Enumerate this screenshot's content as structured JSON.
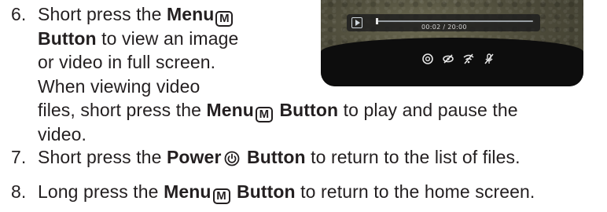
{
  "figure": {
    "timecode": "00:02 / 20:00",
    "status_icons": [
      "aperture-icon",
      "eye-off-icon",
      "wifi-off-icon",
      "mic-off-icon"
    ]
  },
  "steps": [
    {
      "number": "6.",
      "lines": [
        [
          "Short press the ",
          {
            "b": "Menu"
          },
          {
            "kbd": "M"
          }
        ],
        [
          {
            "b": "Button"
          },
          " to view an image"
        ],
        [
          "or video in full screen."
        ],
        [
          "When viewing video"
        ],
        [
          "files, short press the ",
          {
            "b": "Menu"
          },
          {
            "kbd": "M"
          },
          {
            "b": " Button"
          },
          " to play and pause the"
        ],
        [
          "video."
        ]
      ]
    },
    {
      "number": "7.",
      "lines": [
        [
          "Short press the ",
          {
            "b": "Power"
          },
          {
            "pwr": "power"
          },
          {
            "b": " Button"
          },
          " to return to the list of files."
        ]
      ]
    },
    {
      "number": "8.",
      "lines": [
        [
          "Long press the ",
          {
            "b": "Menu"
          },
          {
            "kbd": "M"
          },
          {
            "b": " Button"
          },
          " to return to the home screen."
        ]
      ]
    }
  ]
}
